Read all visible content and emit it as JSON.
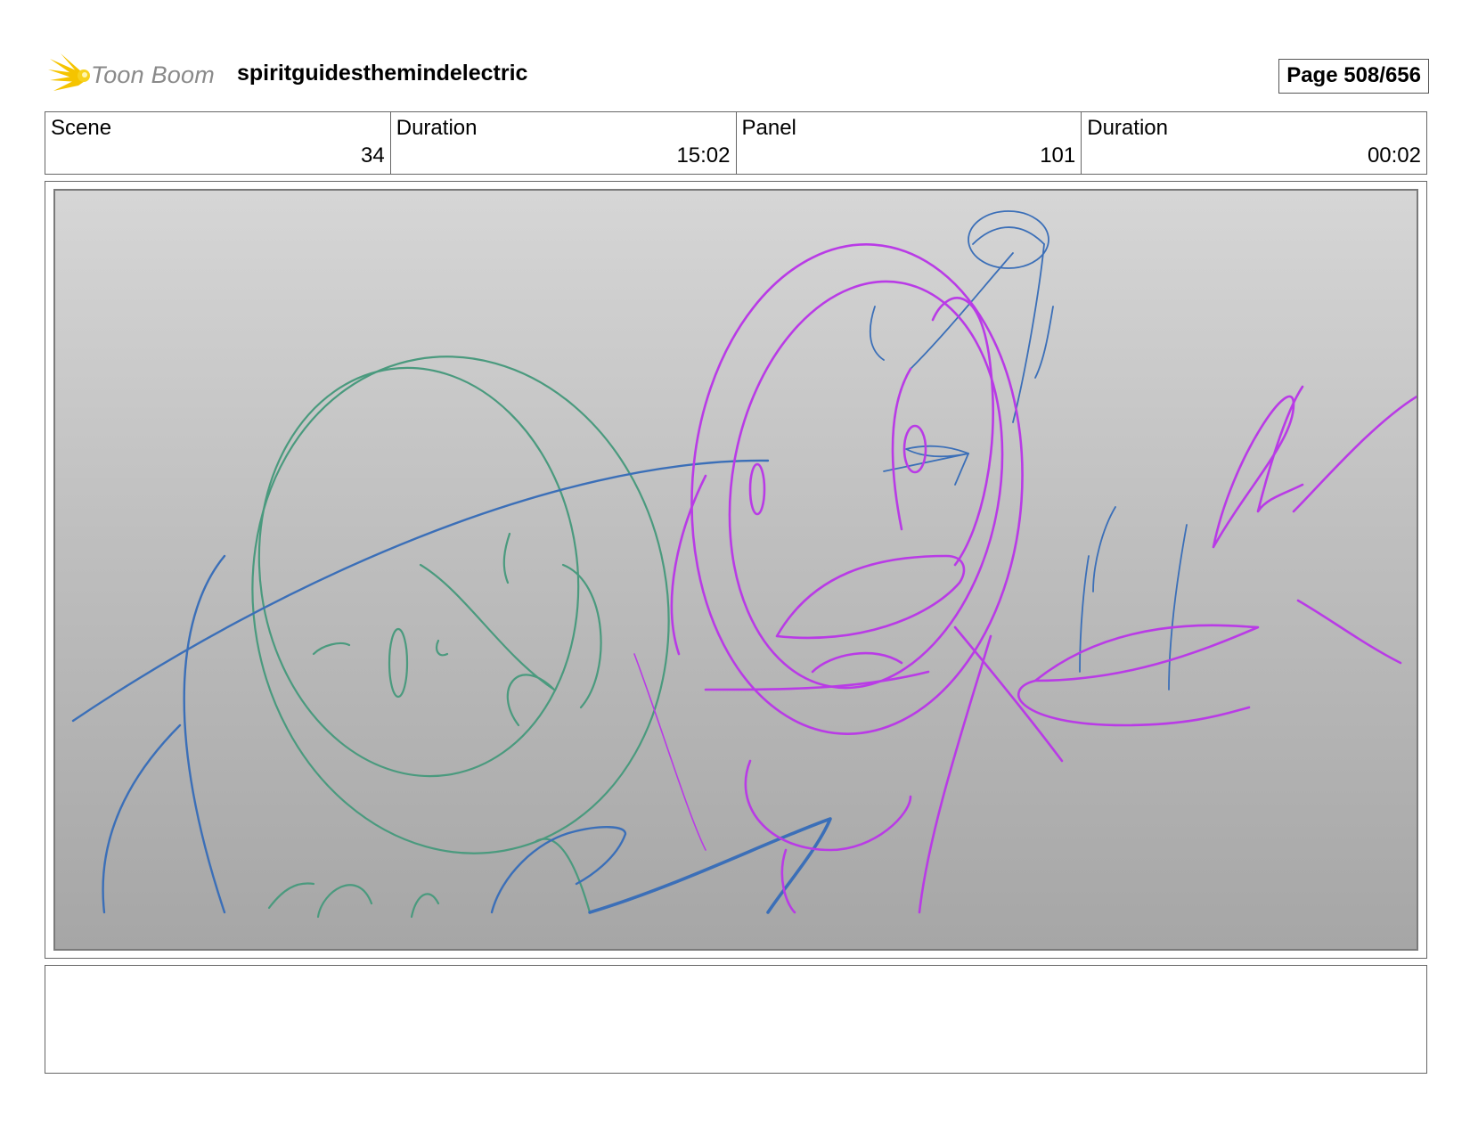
{
  "header": {
    "logo_text": "Toon Boom",
    "project_title": "spiritguidesthemindelectric",
    "page_counter": "Page 508/656"
  },
  "info": [
    {
      "label": "Scene",
      "value": "34"
    },
    {
      "label": "Duration",
      "value": "15:02"
    },
    {
      "label": "Panel",
      "value": "101"
    },
    {
      "label": "Duration",
      "value": "00:02"
    }
  ],
  "panel": {
    "sketch_colors": {
      "green": "#4a9a7e",
      "blue": "#3b6fb8",
      "magenta": "#b93be6"
    }
  },
  "notes": {
    "text": ""
  }
}
